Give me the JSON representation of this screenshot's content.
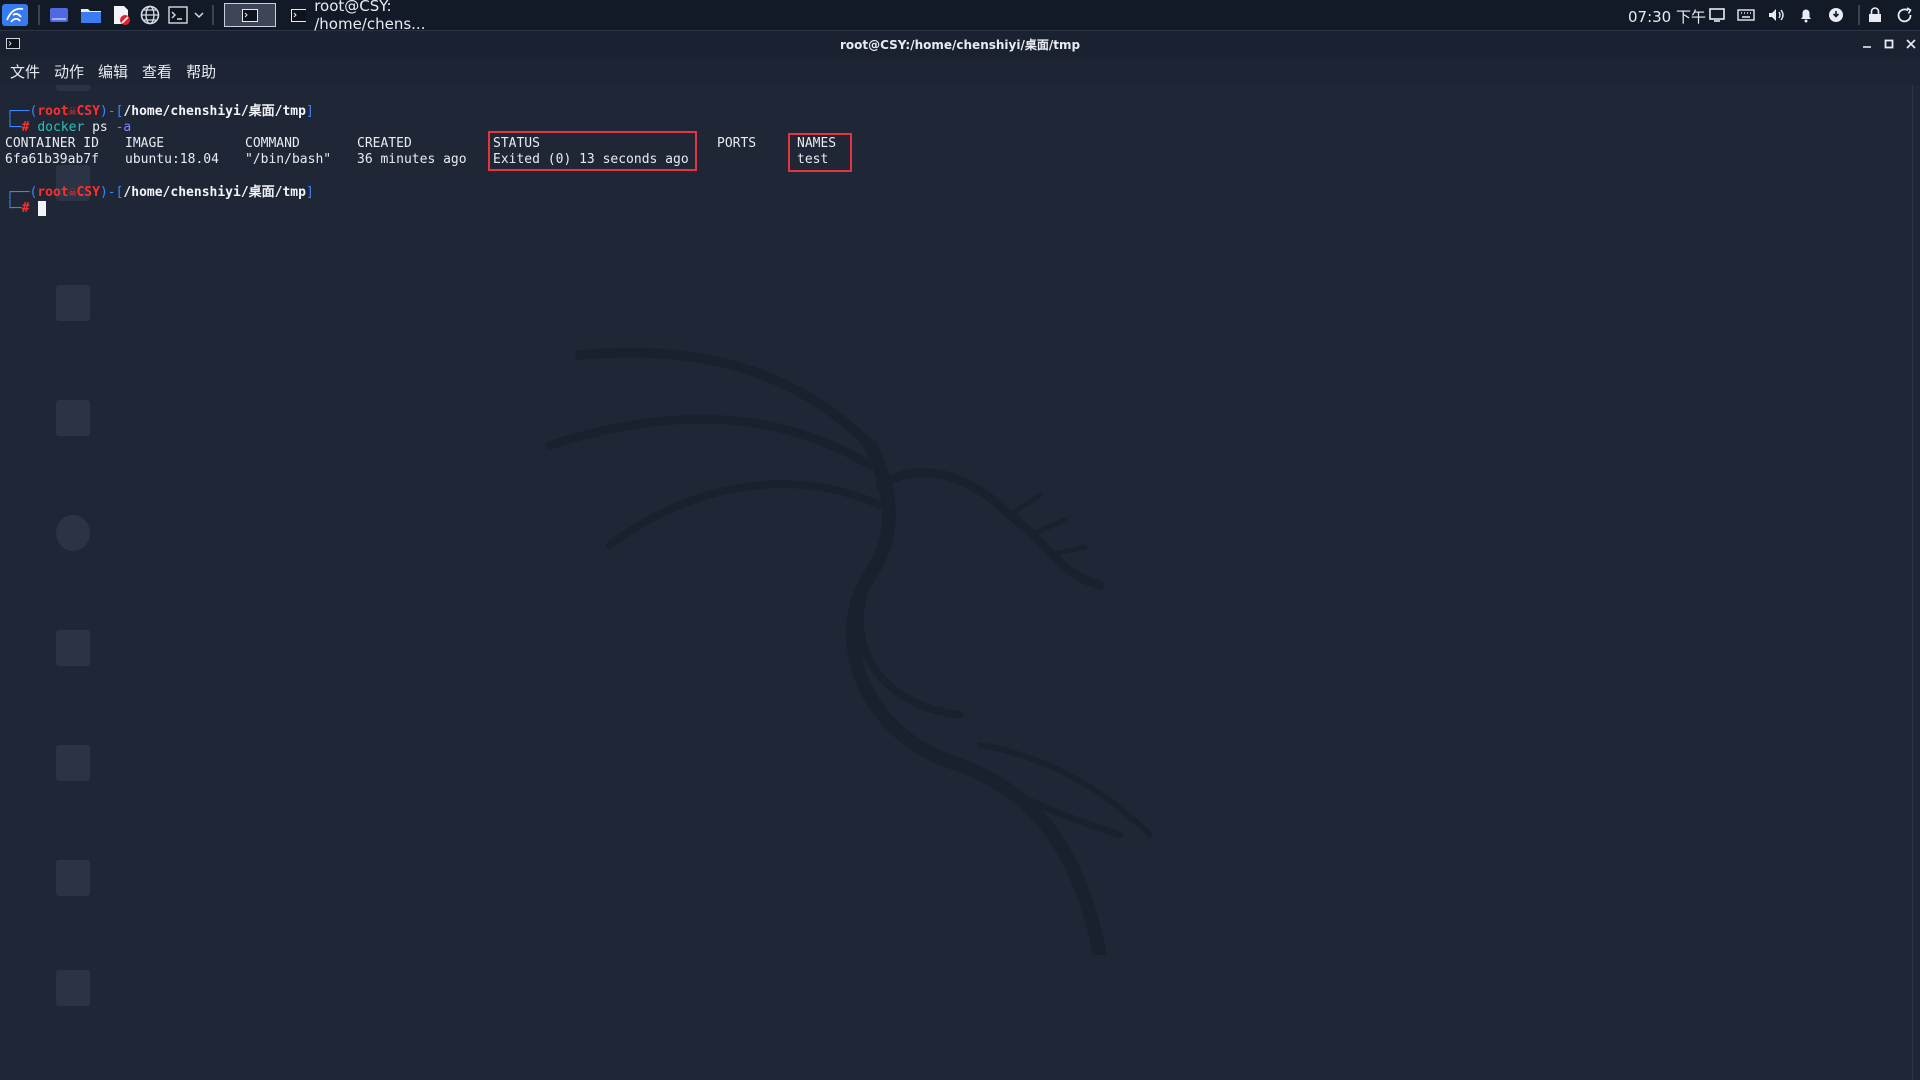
{
  "panel": {
    "task_title": "root@CSY: /home/chens...",
    "clock": "07:30 下午",
    "colors": {
      "accent": "#367bf0",
      "panel_bg": "#121a28"
    }
  },
  "window": {
    "title": "root@CSY:/home/chenshiyi/桌面/tmp"
  },
  "menu": {
    "file": "文件",
    "action": "动作",
    "edit": "编辑",
    "view": "查看",
    "help": "帮助"
  },
  "terminal": {
    "prompt1": {
      "user": "root",
      "host": "CSY",
      "path": "/home/chenshiyi/桌面/tmp"
    },
    "command": {
      "cmd": "docker",
      "arg": "ps",
      "opt": "-a"
    },
    "table": {
      "headers": [
        "CONTAINER ID",
        "IMAGE",
        "COMMAND",
        "CREATED",
        "STATUS",
        "PORTS",
        "NAMES"
      ],
      "row": [
        "6fa61b39ab7f",
        "ubuntu:18.04",
        "\"/bin/bash\"",
        "36 minutes ago",
        "Exited (0) 13 seconds ago",
        "",
        "test"
      ]
    },
    "prompt2": {
      "user": "root",
      "host": "CSY",
      "path": "/home/chenshiyi/桌面/tmp"
    },
    "highlight_color": "#e5343f"
  }
}
